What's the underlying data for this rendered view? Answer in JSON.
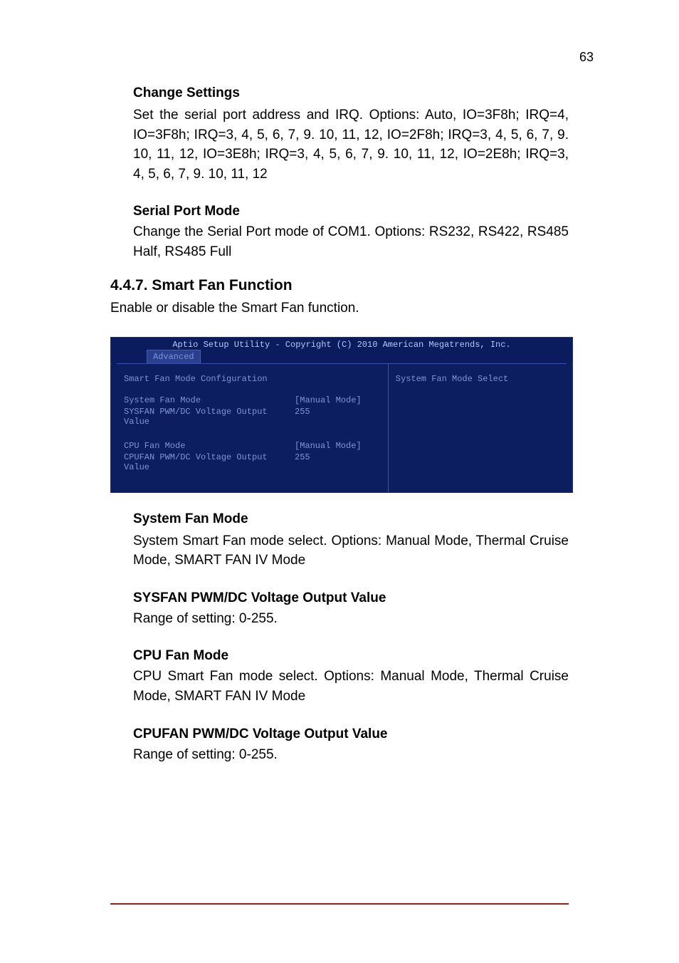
{
  "page_number": "63",
  "s1": {
    "label": "Change Settings",
    "text": "Set the serial port address and IRQ. Options: Auto, IO=3F8h; IRQ=4, IO=3F8h; IRQ=3, 4, 5, 6, 7, 9. 10, 11, 12, IO=2F8h; IRQ=3, 4, 5, 6, 7, 9. 10, 11, 12, IO=3E8h; IRQ=3, 4, 5, 6, 7, 9. 10, 11, 12, IO=2E8h; IRQ=3, 4, 5, 6, 7, 9. 10, 11, 12"
  },
  "s2": {
    "label": "Serial Port Mode",
    "text": "Change the Serial Port mode of COM1. Options: RS232, RS422, RS485 Half, RS485 Full"
  },
  "s3": {
    "heading": "4.4.7. Smart Fan Function",
    "text": "Enable or disable the Smart Fan function."
  },
  "bios": {
    "header": "Aptio Setup Utility - Copyright (C) 2010 American Megatrends, Inc.",
    "tab": "Advanced",
    "section_title": "Smart Fan Mode Configuration",
    "right_help": "System Fan Mode Select",
    "rows": [
      {
        "label": "System Fan Mode",
        "value": "[Manual Mode]"
      },
      {
        "label": "SYSFAN PWM/DC Voltage Output Value",
        "value": "255"
      },
      {
        "label": "",
        "value": ""
      },
      {
        "label": "CPU Fan Mode",
        "value": "[Manual Mode]"
      },
      {
        "label": "CPUFAN PWM/DC Voltage Output Value",
        "value": "255"
      }
    ]
  },
  "s4": {
    "label": "System Fan Mode",
    "text": "System Smart Fan mode select. Options: Manual Mode, Thermal Cruise Mode, SMART FAN IV Mode"
  },
  "s5": {
    "label": "SYSFAN PWM/DC Voltage Output Value",
    "text": "Range of setting: 0-255."
  },
  "s6": {
    "label": "CPU Fan Mode",
    "text": "CPU Smart Fan mode select. Options: Manual Mode, Thermal Cruise Mode, SMART FAN IV Mode"
  },
  "s7": {
    "label": "CPUFAN PWM/DC Voltage Output Value",
    "text": "Range of setting: 0-255."
  },
  "footer_left": "",
  "footer_right": ""
}
